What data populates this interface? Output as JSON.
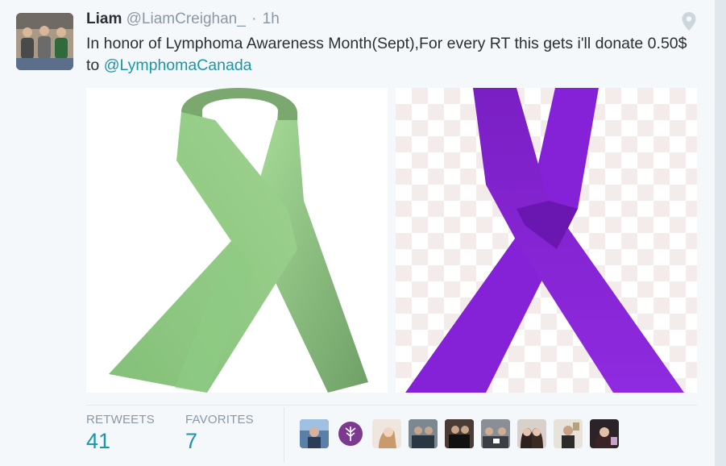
{
  "tweet": {
    "name": "Liam",
    "handle": "@LiamCreighan_",
    "separator": "·",
    "time": "1h",
    "text_before": "In honor of Lymphoma Awareness Month(Sept),For every RT this gets i'll donate 0.50$ to ",
    "mention": "@LymphomaCanada",
    "images": [
      {
        "subject": "green awareness ribbon",
        "ribbon_color": "#8fcf85"
      },
      {
        "subject": "purple awareness ribbon",
        "ribbon_color": "#8a22d6"
      }
    ]
  },
  "stats": {
    "retweets_label": "RETWEETS",
    "retweets_value": "41",
    "favorites_label": "FAVORITES",
    "favorites_value": "7"
  },
  "icons": {
    "location": "map-pin-icon"
  },
  "colors": {
    "link": "#1b95a8",
    "text": "#292f33",
    "muted": "#8899a6",
    "background": "#f5f8fa"
  },
  "favoriters_count": 9
}
